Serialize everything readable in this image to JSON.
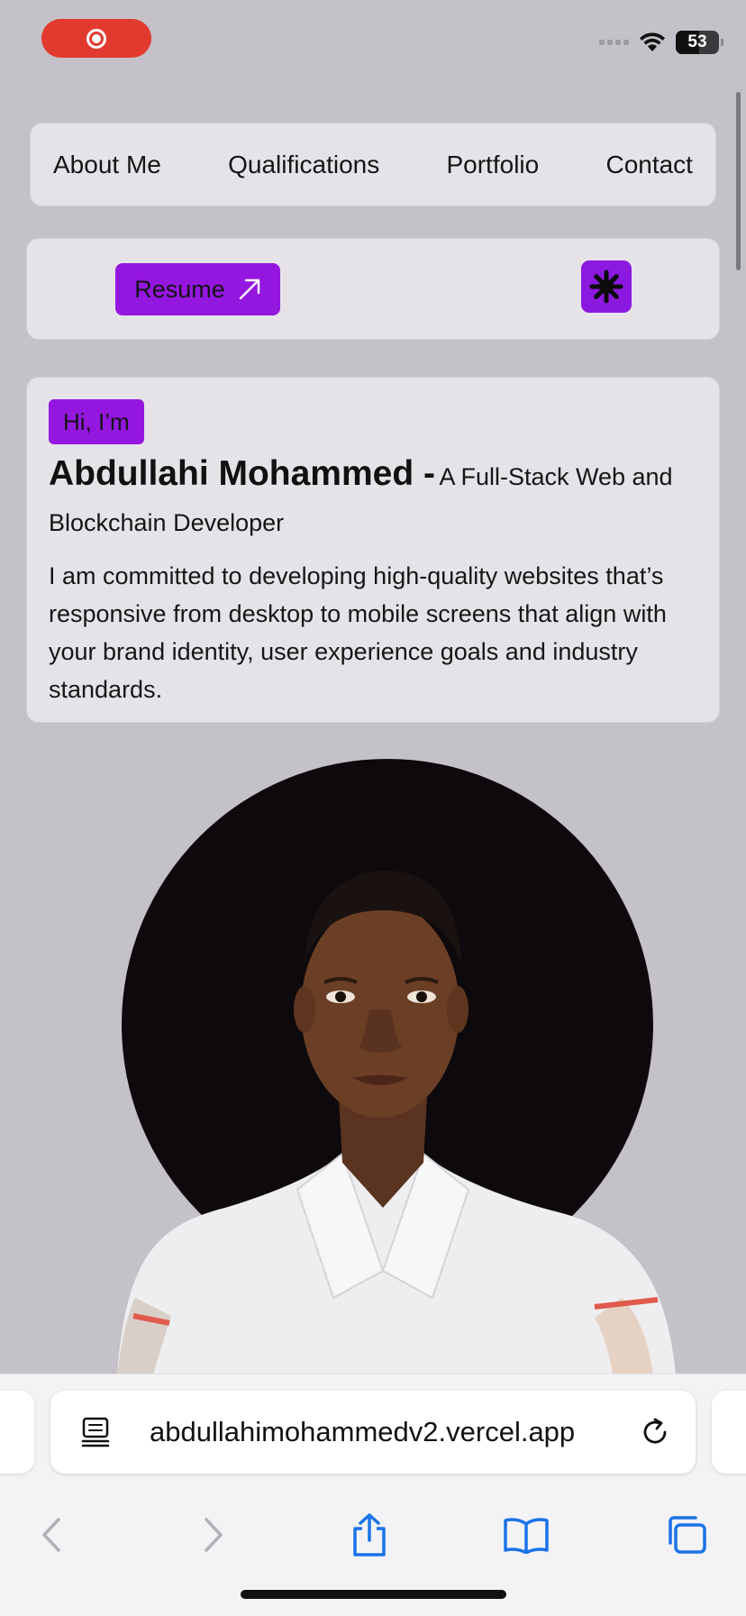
{
  "status_bar": {
    "battery": "53"
  },
  "nav": {
    "items": [
      {
        "label": "About Me"
      },
      {
        "label": "Qualifications"
      },
      {
        "label": "Portfolio"
      },
      {
        "label": "Contact"
      }
    ]
  },
  "actions": {
    "resume_label": "Resume",
    "resume_icon": "arrow-up-right-icon",
    "theme_icon": "gear-icon"
  },
  "hero": {
    "greeting": "Hi, I’m",
    "name": "Abdullahi Mohammed -",
    "role": "A Full-Stack Web and Blockchain Developer",
    "description": "I am committed to developing high-quality websites that’s responsive from desktop to mobile screens that align with your brand identity, user experience goals and industry standards."
  },
  "browser": {
    "url": "abdullahimohammedv2.vercel.app",
    "accent": "#9417e0"
  }
}
